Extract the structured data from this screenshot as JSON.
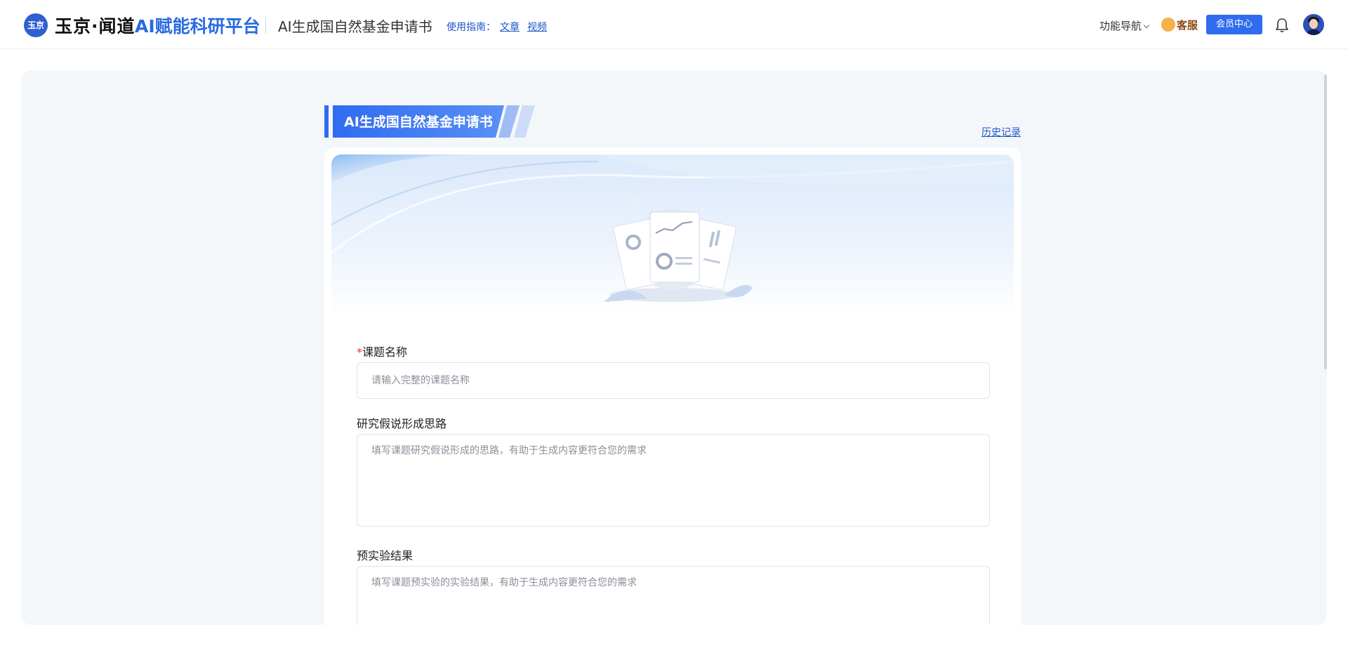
{
  "header": {
    "logo_text": "玉京",
    "brand": "玉京·闻道",
    "brand_ai": "AI赋能科研平台",
    "page_title": "AI生成国自然基金申请书",
    "guide_label": "使用指南：",
    "guide_links": [
      "文章",
      "视频"
    ],
    "nav_menu": "功能导航",
    "service": "客服",
    "member_center": "会员中心",
    "icons": [
      "bell-icon",
      "chevron-down-icon",
      "headset-icon"
    ]
  },
  "main": {
    "section_title": "AI生成国自然基金申请书",
    "history_link": "历史记录",
    "fields": [
      {
        "label": "课题名称",
        "required": true,
        "placeholder": "请输入完整的课题名称",
        "value": ""
      },
      {
        "label": "研究假说形成思路",
        "required": false,
        "placeholder": "填写课题研究假说形成的思路，有助于生成内容更符合您的需求",
        "value": ""
      },
      {
        "label": "预实验结果",
        "required": false,
        "placeholder": "填写课题预实验的实验结果，有助于生成内容更符合您的需求",
        "value": ""
      }
    ]
  },
  "colors": {
    "accent": "#2f6cf0",
    "brand_blue": "#2a6ae0",
    "link": "#1d56c9",
    "required": "#e23030",
    "page_bg": "#f4f7fa"
  }
}
